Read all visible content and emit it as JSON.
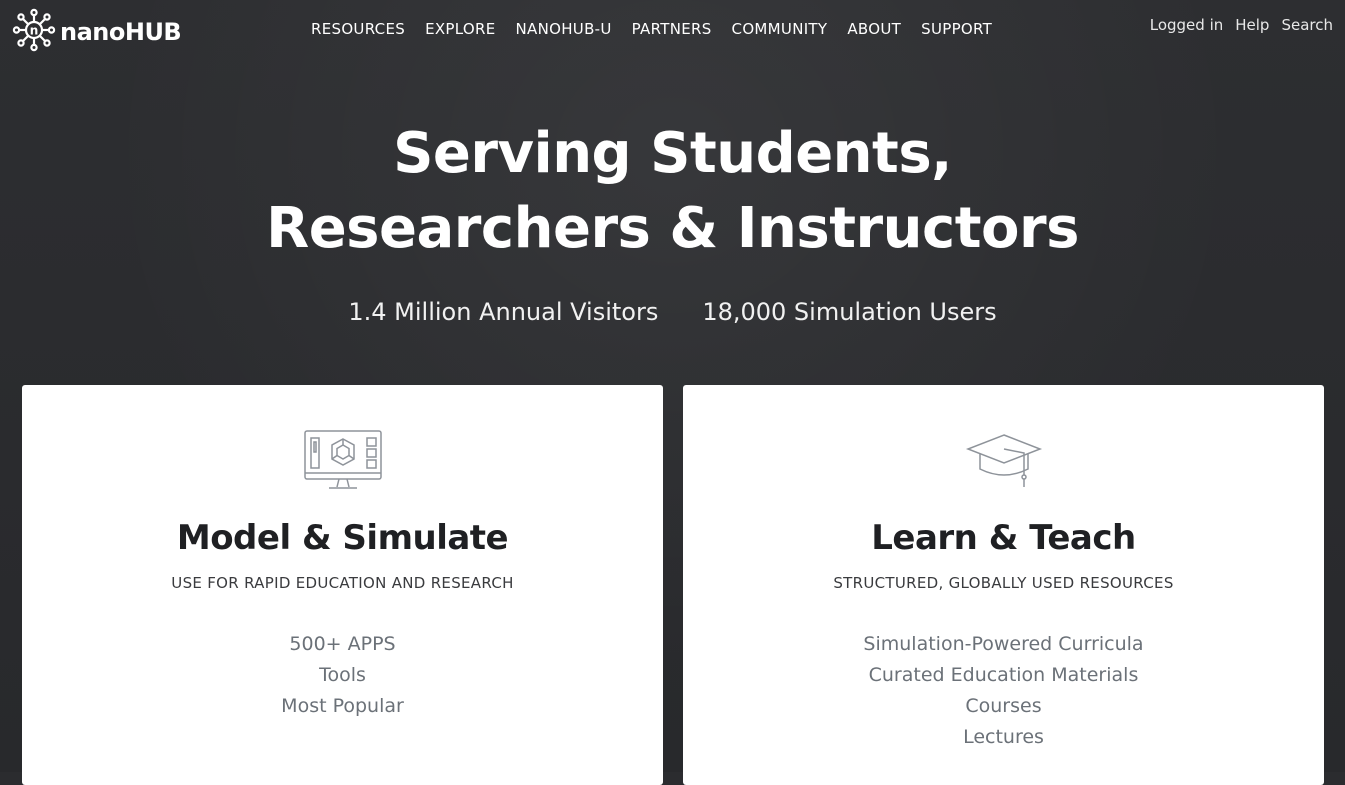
{
  "logo": {
    "text": "nanoHUB",
    "icon": "nanohub-molecule-logo-icon"
  },
  "nav": [
    {
      "label": "RESOURCES"
    },
    {
      "label": "EXPLORE"
    },
    {
      "label": "NANOHUB-U"
    },
    {
      "label": "PARTNERS"
    },
    {
      "label": "COMMUNITY"
    },
    {
      "label": "ABOUT"
    },
    {
      "label": "SUPPORT"
    }
  ],
  "utility": {
    "logged_in": "Logged in",
    "help": "Help",
    "search": "Search"
  },
  "hero": {
    "title_line1": "Serving Students,",
    "title_line2": "Researchers & Instructors",
    "stat1": "1.4 Million Annual Visitors",
    "stat2": "18,000 Simulation Users"
  },
  "cards": [
    {
      "icon": "computer-simulation-icon",
      "title": "Model & Simulate",
      "subtitle": "USE FOR RAPID EDUCATION AND RESEARCH",
      "links": [
        "500+ APPS",
        "Tools",
        "Most Popular"
      ]
    },
    {
      "icon": "graduation-cap-icon",
      "title": "Learn & Teach",
      "subtitle": "STRUCTURED, GLOBALLY USED RESOURCES",
      "links": [
        "Simulation-Powered Curricula",
        "Curated Education Materials",
        "Courses",
        "Lectures"
      ]
    }
  ],
  "colors": {
    "background": "#2b2c2f",
    "card": "#ffffff",
    "link": "#6b7178",
    "title": "#1f2023"
  }
}
